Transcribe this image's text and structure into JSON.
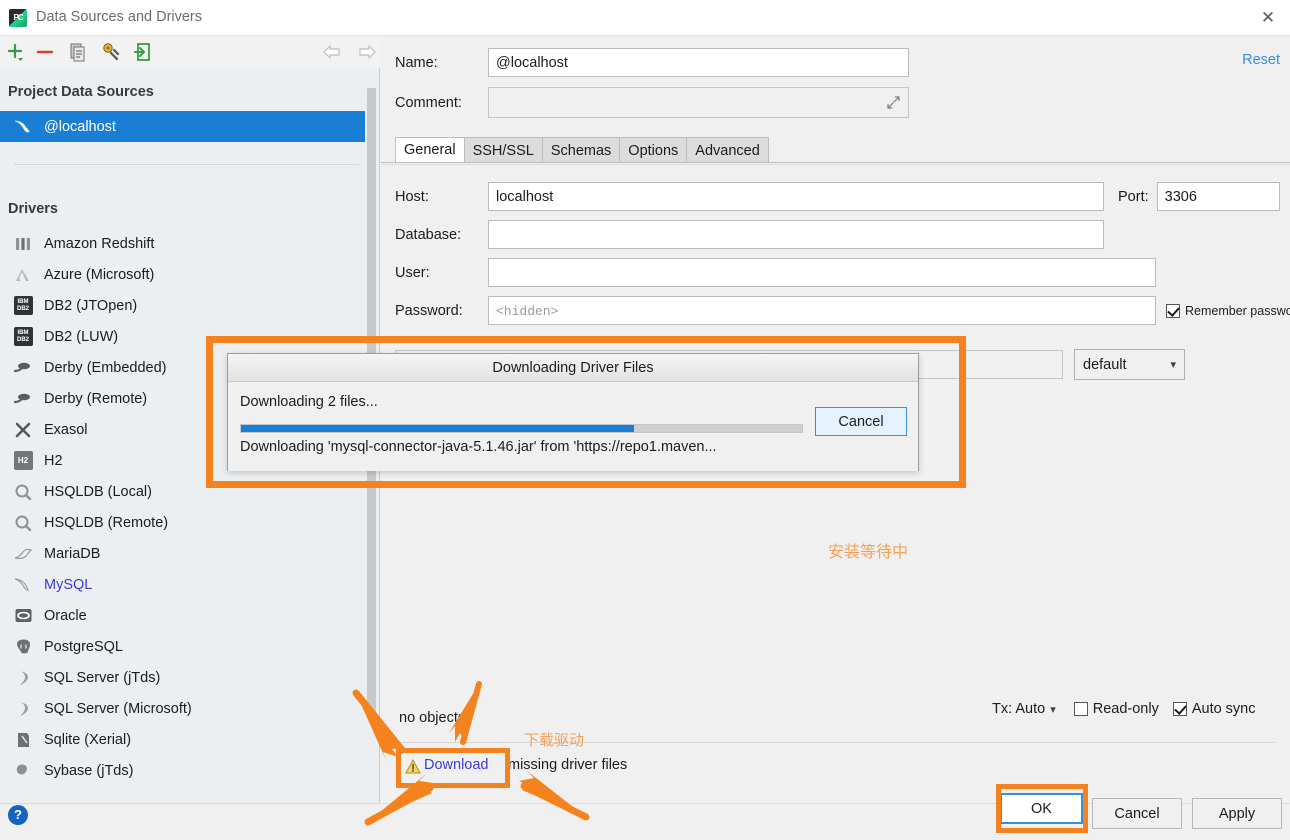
{
  "window": {
    "title": "Data Sources and Drivers",
    "app_icon": "pycharm-icon",
    "close_label": "✕"
  },
  "left_panel": {
    "toolbar": [
      {
        "name": "add-button",
        "label": "+"
      },
      {
        "name": "remove-button",
        "label": "−"
      },
      {
        "name": "copy-button",
        "label": "Copy"
      },
      {
        "name": "driver-properties-button",
        "label": "Driver Properties"
      },
      {
        "name": "import-button",
        "label": "Import"
      }
    ],
    "nav": [
      {
        "name": "back-arrow",
        "label": "⇦"
      },
      {
        "name": "forward-arrow",
        "label": "⇨"
      }
    ],
    "project_sources_header": "Project Data Sources",
    "data_sources": [
      {
        "label": "@localhost",
        "icon": "mysql-dolphin-icon",
        "selected": true
      }
    ],
    "drivers_header": "Drivers",
    "drivers": [
      {
        "label": "Amazon Redshift",
        "icon": "redshift-icon",
        "highlight": false
      },
      {
        "label": "Azure (Microsoft)",
        "icon": "azure-icon",
        "highlight": false
      },
      {
        "label": "DB2 (JTOpen)",
        "icon": "db2-icon",
        "highlight": false
      },
      {
        "label": "DB2 (LUW)",
        "icon": "db2-icon",
        "highlight": false
      },
      {
        "label": "Derby (Embedded)",
        "icon": "derby-icon",
        "highlight": false
      },
      {
        "label": "Derby (Remote)",
        "icon": "derby-icon",
        "highlight": false
      },
      {
        "label": "Exasol",
        "icon": "exasol-icon",
        "highlight": false
      },
      {
        "label": "H2",
        "icon": "h2-icon",
        "highlight": false
      },
      {
        "label": "HSQLDB (Local)",
        "icon": "hsqldb-icon",
        "highlight": false
      },
      {
        "label": "HSQLDB (Remote)",
        "icon": "hsqldb-icon",
        "highlight": false
      },
      {
        "label": "MariaDB",
        "icon": "mariadb-icon",
        "highlight": false
      },
      {
        "label": "MySQL",
        "icon": "mysql-dolphin-icon",
        "highlight": true
      },
      {
        "label": "Oracle",
        "icon": "oracle-icon",
        "highlight": false
      },
      {
        "label": "PostgreSQL",
        "icon": "postgresql-icon",
        "highlight": false
      },
      {
        "label": "SQL Server (jTds)",
        "icon": "sqlserver-icon",
        "highlight": false
      },
      {
        "label": "SQL Server (Microsoft)",
        "icon": "sqlserver-icon",
        "highlight": false
      },
      {
        "label": "Sqlite (Xerial)",
        "icon": "sqlite-icon",
        "highlight": false
      },
      {
        "label": "Sybase (jTds)",
        "icon": "sybase-icon",
        "highlight": false
      }
    ]
  },
  "form": {
    "name_label": "Name:",
    "name_value": "@localhost",
    "comment_label": "Comment:",
    "comment_value": "",
    "comment_expand_icon": "expand-icon",
    "reset_label": "Reset",
    "tabs": [
      {
        "label": "General",
        "active": true
      },
      {
        "label": "SSH/SSL",
        "active": false
      },
      {
        "label": "Schemas",
        "active": false
      },
      {
        "label": "Options",
        "active": false
      },
      {
        "label": "Advanced",
        "active": false
      }
    ],
    "host_label": "Host:",
    "host_value": "localhost",
    "port_label": "Port:",
    "port_value": "3306",
    "database_label": "Database:",
    "database_value": "",
    "user_label": "User:",
    "user_value": "",
    "password_label": "Password:",
    "password_placeholder": "<hidden>",
    "remember_password_label": "Remember password",
    "remember_password_checked": true,
    "driver_select_value": "default"
  },
  "status_bar": {
    "no_objects_text": "no objects",
    "warning_icon": "warning-triangle-icon",
    "download_link": "Download",
    "download_rest": "missing driver files",
    "tx_label": "Tx: Auto",
    "tx_caret_icon": "chevron-down-icon",
    "read_only_label": "Read-only",
    "read_only_checked": false,
    "auto_sync_label": "Auto sync",
    "auto_sync_checked": true
  },
  "footer": {
    "help_label": "?",
    "ok_label": "OK",
    "cancel_label": "Cancel",
    "apply_label": "Apply"
  },
  "dialog": {
    "title": "Downloading Driver Files",
    "line1": "Downloading 2 files...",
    "progress_percent": 70,
    "line2": "Downloading 'mysql-connector-java-5.1.46.jar' from 'https://repo1.maven...",
    "cancel_label": "Cancel"
  },
  "annotations": {
    "highlight_color": "#f4821f",
    "note_installing": "安装等待中",
    "note_download_driver": "下载驱动"
  }
}
